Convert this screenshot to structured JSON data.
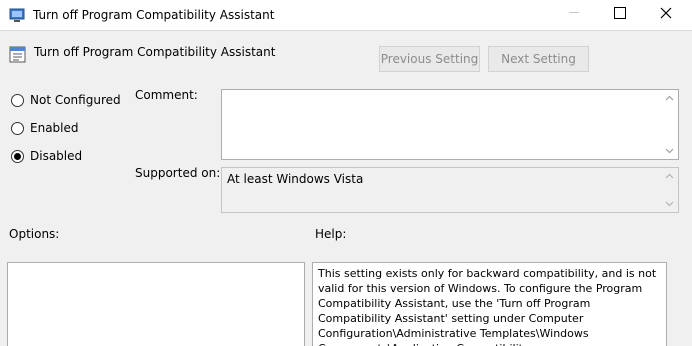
{
  "window": {
    "title": "Turn off Program Compatibility Assistant"
  },
  "header": {
    "title": "Turn off Program Compatibility Assistant"
  },
  "nav": {
    "previous_label": "Previous Setting",
    "next_label": "Next Setting"
  },
  "state": {
    "options": [
      {
        "label": "Not Configured",
        "checked": false
      },
      {
        "label": "Enabled",
        "checked": false
      },
      {
        "label": "Disabled",
        "checked": true
      }
    ]
  },
  "comment": {
    "label": "Comment:",
    "value": ""
  },
  "supported": {
    "label": "Supported on:",
    "value": "At least Windows Vista"
  },
  "options_panel": {
    "label": "Options:"
  },
  "help_panel": {
    "label": "Help:",
    "text": "This setting exists only for backward compatibility, and is not valid for this version of Windows. To configure the Program Compatibility Assistant, use the 'Turn off Program Compatibility Assistant' setting under Computer Configuration\\Administrative Templates\\Windows Components\\Application Compatibility."
  }
}
